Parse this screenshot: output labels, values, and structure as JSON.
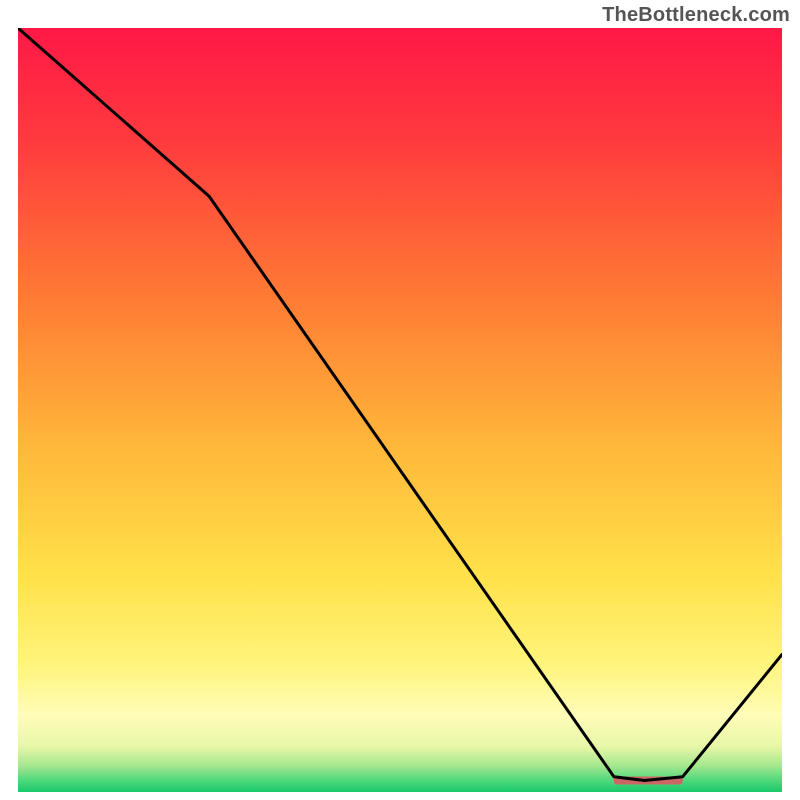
{
  "watermark": {
    "text": "TheBottleneck.com"
  },
  "chart_data": {
    "type": "line",
    "title": "",
    "xlabel": "",
    "ylabel": "",
    "xlim": [
      0,
      100
    ],
    "ylim": [
      0,
      100
    ],
    "grid": false,
    "axes": false,
    "series": [
      {
        "name": "curve",
        "x": [
          0,
          25,
          78,
          82,
          87,
          100
        ],
        "values": [
          100,
          78,
          2,
          1.5,
          2,
          18
        ]
      }
    ],
    "marker": {
      "name": "highlight-bar",
      "x_start": 78,
      "x_end": 87,
      "y": 1.5,
      "color": "#CC6666"
    },
    "background_gradient": {
      "stops": [
        {
          "offset": 0.0,
          "color": "#FF1846"
        },
        {
          "offset": 0.15,
          "color": "#FF3B3E"
        },
        {
          "offset": 0.35,
          "color": "#FF7A34"
        },
        {
          "offset": 0.55,
          "color": "#FFB83A"
        },
        {
          "offset": 0.72,
          "color": "#FFE24A"
        },
        {
          "offset": 0.83,
          "color": "#FFF47A"
        },
        {
          "offset": 0.9,
          "color": "#FFFDB8"
        },
        {
          "offset": 0.94,
          "color": "#E8F7A8"
        },
        {
          "offset": 0.965,
          "color": "#A7E88F"
        },
        {
          "offset": 0.985,
          "color": "#4FD87C"
        },
        {
          "offset": 1.0,
          "color": "#18C96A"
        }
      ]
    }
  }
}
